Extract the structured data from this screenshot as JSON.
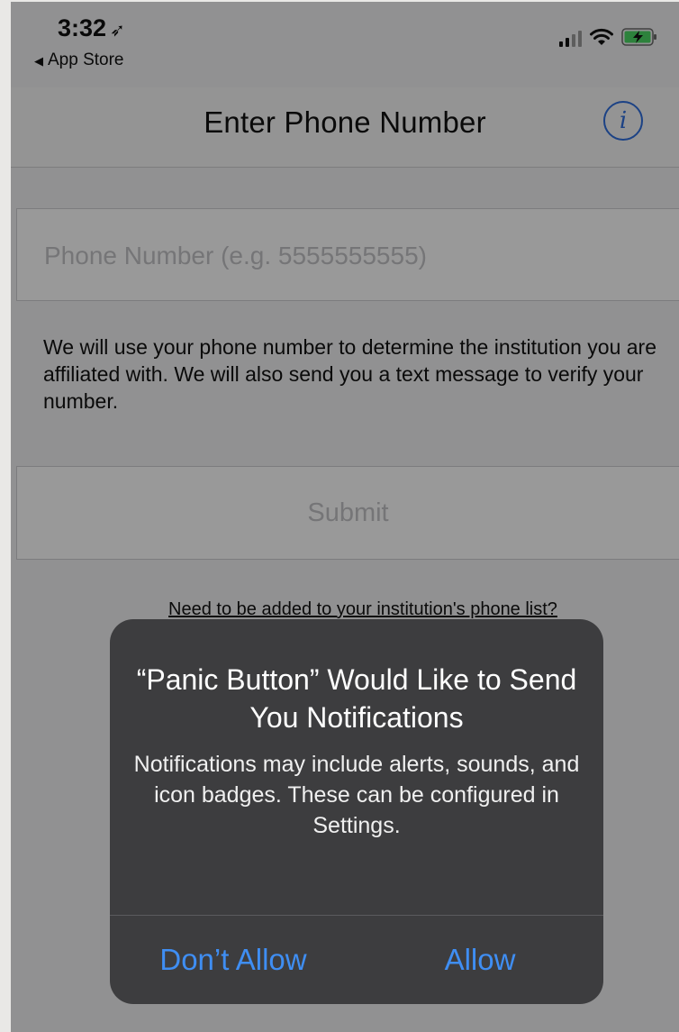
{
  "status_bar": {
    "time": "3:32",
    "location_glyph": "➶",
    "back_label": "App Store",
    "back_glyph": "◀"
  },
  "nav": {
    "title": "Enter Phone Number",
    "info_glyph": "i"
  },
  "form": {
    "phone_placeholder": "Phone Number (e.g. 5555555555)",
    "phone_value": "",
    "explanation": "We will use your phone number to determine the institution you are affiliated with. We will also send you a text message to verify your number.",
    "submit_label": "Submit",
    "need_link": "Need to be added to your institution's phone list?"
  },
  "alert": {
    "title": "“Panic Button” Would Like to Send You Notifications",
    "message": "Notifications may include alerts, sounds, and icon badges. These can be configured in Settings.",
    "dont_allow_label": "Don’t Allow",
    "allow_label": "Allow"
  },
  "colors": {
    "accent": "#2f6fde",
    "alert_button": "#3f8ef3",
    "battery_green": "#4cd964"
  }
}
